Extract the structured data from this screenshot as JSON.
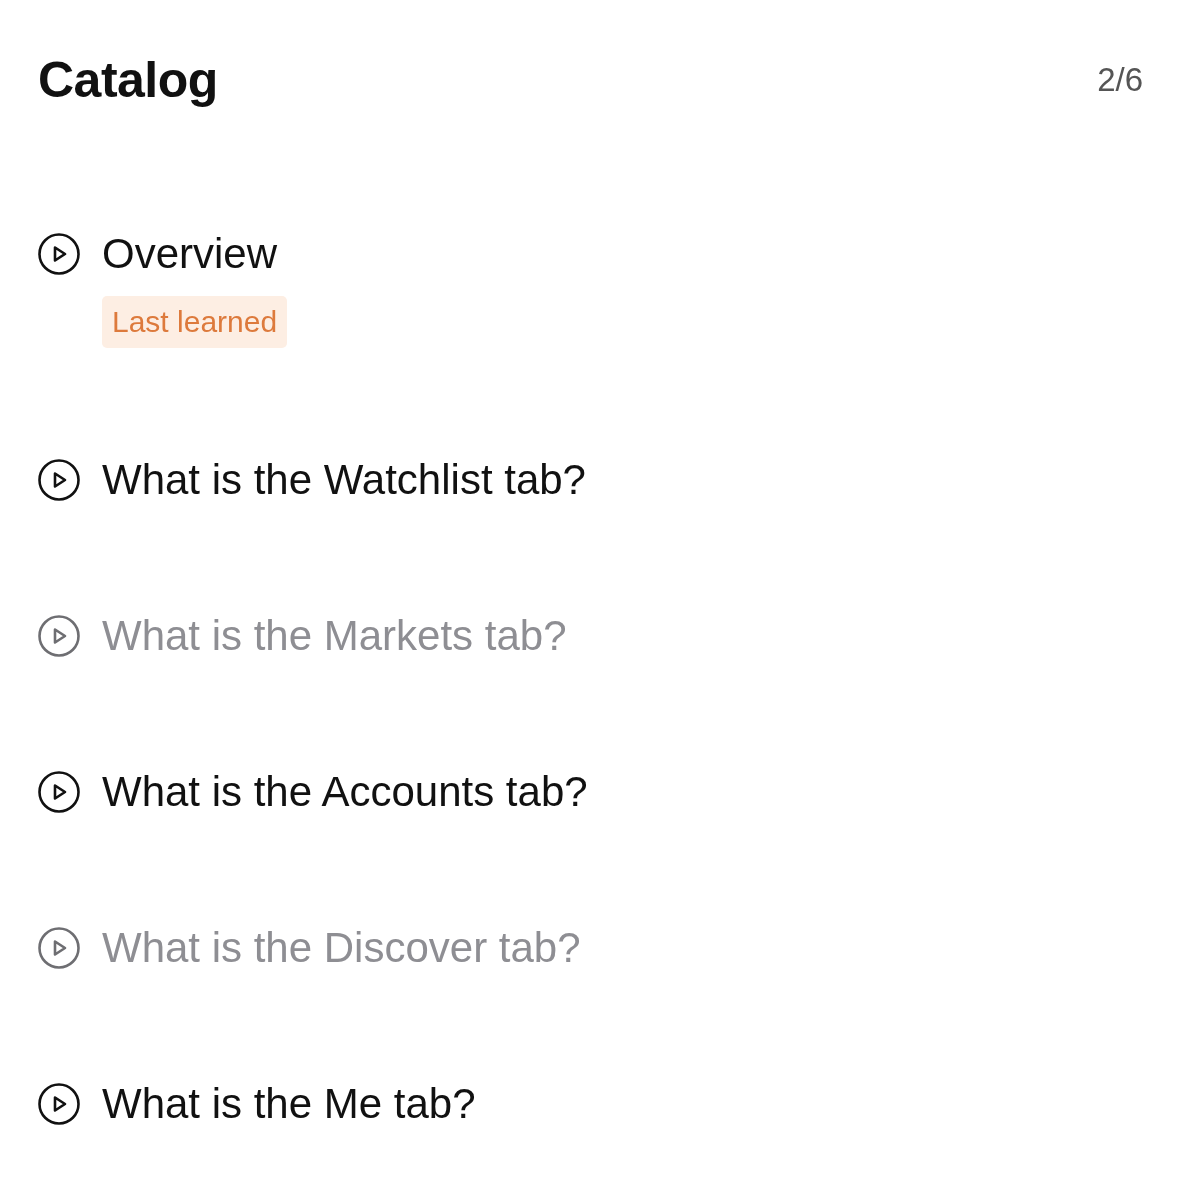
{
  "header": {
    "title": "Catalog",
    "progress": "2/6"
  },
  "lessons": [
    {
      "title": "Overview",
      "badge": "Last learned",
      "disabled": false
    },
    {
      "title": "What is the Watchlist tab?",
      "disabled": false
    },
    {
      "title": "What is the Markets tab?",
      "disabled": true
    },
    {
      "title": "What is the Accounts tab?",
      "disabled": false
    },
    {
      "title": "What is the Discover tab?",
      "disabled": true
    },
    {
      "title": "What is the Me tab?",
      "disabled": false
    }
  ]
}
